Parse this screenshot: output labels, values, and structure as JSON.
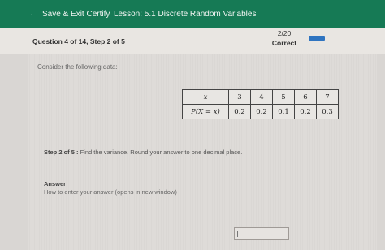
{
  "topbar": {
    "save_exit_label": "Save & Exit Certify",
    "lesson_label": "Lesson: 5.1 Discrete Random Variables"
  },
  "header": {
    "question_step": "Question 4 of 14, Step 2 of 5",
    "score": "2/20",
    "status": "Correct",
    "progress_fraction": 0.25
  },
  "main": {
    "prompt": "Consider the following data:",
    "table": {
      "row1": [
        "x",
        "3",
        "4",
        "5",
        "6",
        "7"
      ],
      "row2": [
        "P(X = x)",
        "0.2",
        "0.2",
        "0.1",
        "0.2",
        "0.3"
      ]
    },
    "step_label": "Step 2 of 5 :",
    "step_text": " Find the variance. Round your answer to one decimal place.",
    "answer_label": "Answer",
    "howto_link": "How to enter your answer (opens in new window)",
    "answer_value": ""
  },
  "colors": {
    "topbar": "#167a55",
    "progress": "#2f74c0"
  }
}
